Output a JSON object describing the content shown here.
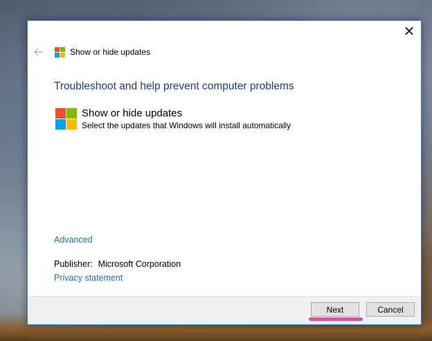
{
  "window": {
    "close_glyph": "✕",
    "title": "Show or hide updates"
  },
  "content": {
    "heading": "Troubleshoot and help prevent computer problems",
    "item": {
      "title": "Show or hide updates",
      "description": "Select the updates that Windows will install automatically"
    },
    "advanced_link": "Advanced",
    "publisher_label": "Publisher:",
    "publisher_value": "Microsoft Corporation",
    "privacy_link": "Privacy statement"
  },
  "footer": {
    "next_label": "Next",
    "cancel_label": "Cancel"
  },
  "icons": {
    "back": "arrow-left-icon",
    "logo": "windows-logo-icon",
    "close": "close-icon"
  },
  "colors": {
    "logo_red": "#f25022",
    "logo_green": "#7fba00",
    "logo_blue": "#00a4ef",
    "logo_yellow": "#ffb900",
    "heading": "#1e3f85",
    "link": "#1b6fb8",
    "highlight": "#e0509a",
    "window_border": "#3c78c8"
  }
}
